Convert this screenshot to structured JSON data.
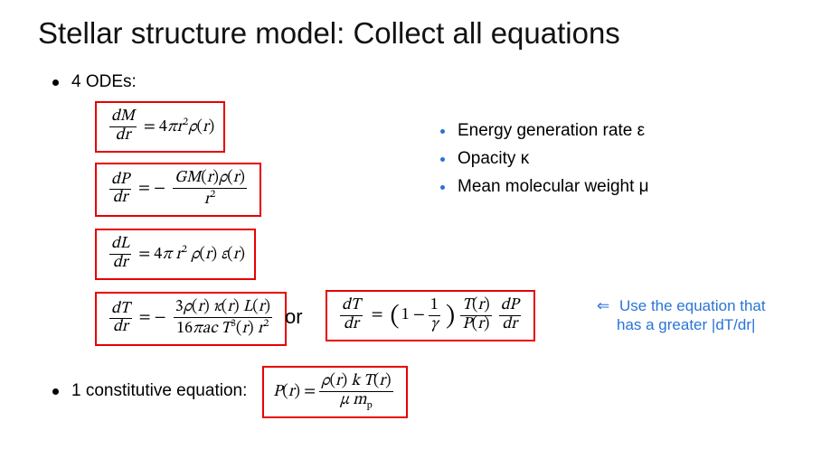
{
  "title": "Stellar structure model: Collect all equations",
  "bullets": {
    "ode_label": "4 ODEs:",
    "constitutive_label": "1 constitutive equation:"
  },
  "side_list": {
    "item1": "Energy generation rate ε",
    "item2": "Opacity κ",
    "item3": "Mean molecular weight μ"
  },
  "equations": {
    "mass": {
      "lhs_num": "dM",
      "lhs_den": "dr",
      "rhs": "= 4πr²ρ(r)"
    },
    "hydro": {
      "lhs_num": "dP",
      "lhs_den": "dr",
      "eq_sign": "= −",
      "rhs_num": "GM(r)ρ(r)",
      "rhs_den": "r²"
    },
    "luminosity": {
      "lhs_num": "dL",
      "lhs_den": "dr",
      "rhs": "= 4π r² ρ(r) ε(r)"
    },
    "radiative": {
      "lhs_num": "dT",
      "lhs_den": "dr",
      "eq_sign": "= −",
      "rhs_num": "3ρ(r) κ(r) L(r)",
      "rhs_den": "16πac T³(r) r²"
    },
    "convective": {
      "lhs_num": "dT",
      "lhs_den": "dr",
      "eq_sign": "=",
      "paren_inner_num": "1",
      "paren_inner_den": "γ",
      "paren_lead": "1 −",
      "rhs_frac1_num": "T(r)",
      "rhs_frac1_den": "P(r)",
      "rhs_frac2_num": "dP",
      "rhs_frac2_den": "dr"
    },
    "eos": {
      "lhs": "P(r) =",
      "rhs_num": "ρ(r) k T(r)",
      "rhs_den": "μ mₚ"
    }
  },
  "or_text": "or",
  "hint": {
    "arrow": "⇐",
    "line1": "Use the equation that",
    "line2": "has a greater |dT/dr|"
  }
}
